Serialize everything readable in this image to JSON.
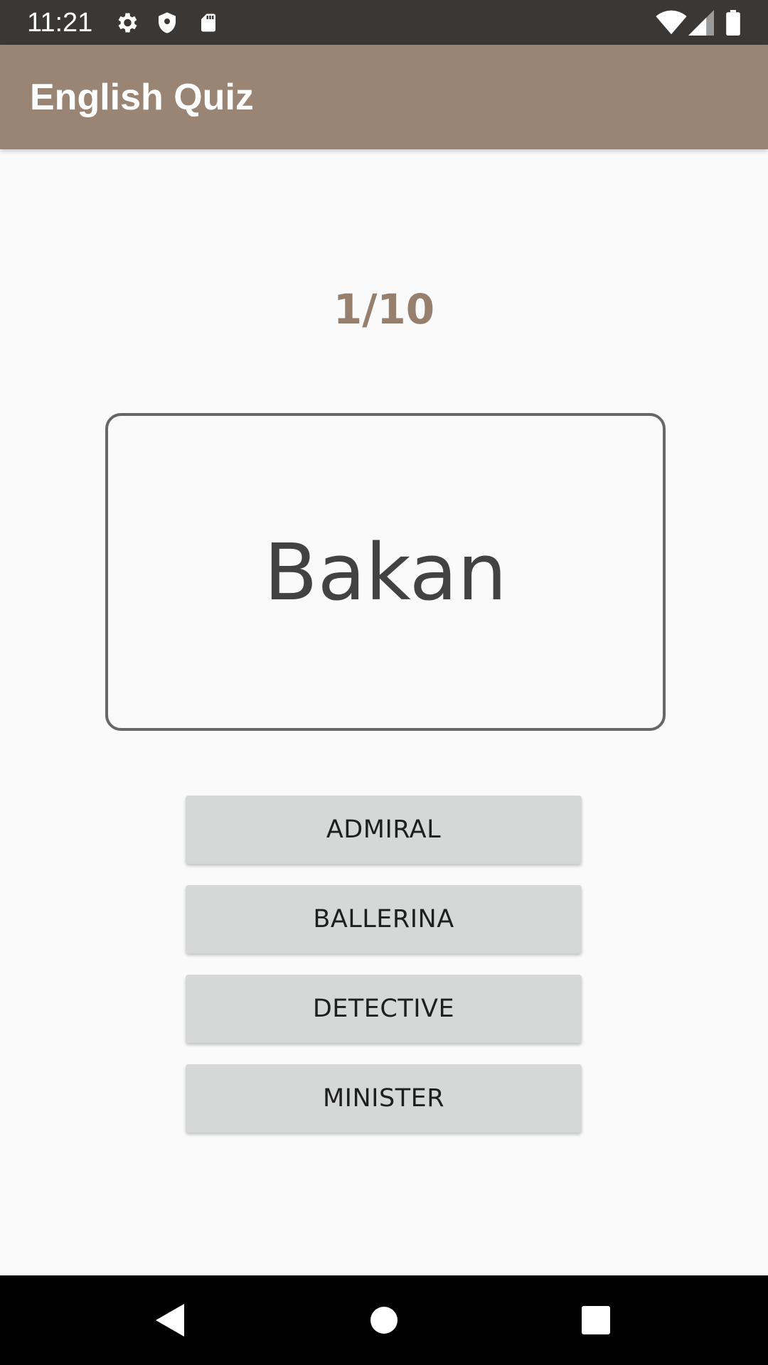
{
  "status_bar": {
    "time": "11:21",
    "icons": [
      "settings-icon",
      "shield-icon",
      "sd-card-icon",
      "wifi-icon",
      "signal-icon",
      "battery-icon"
    ]
  },
  "app_bar": {
    "title": "English Quiz",
    "color": "#9a8574"
  },
  "quiz": {
    "progress": "1/10",
    "progress_color": "#977f6d",
    "word": "Bakan",
    "answers": [
      "ADMIRAL",
      "BALLERINA",
      "DETECTIVE",
      "MINISTER"
    ]
  },
  "nav_bar": {
    "buttons": [
      "back-icon",
      "home-icon",
      "recents-icon"
    ]
  }
}
